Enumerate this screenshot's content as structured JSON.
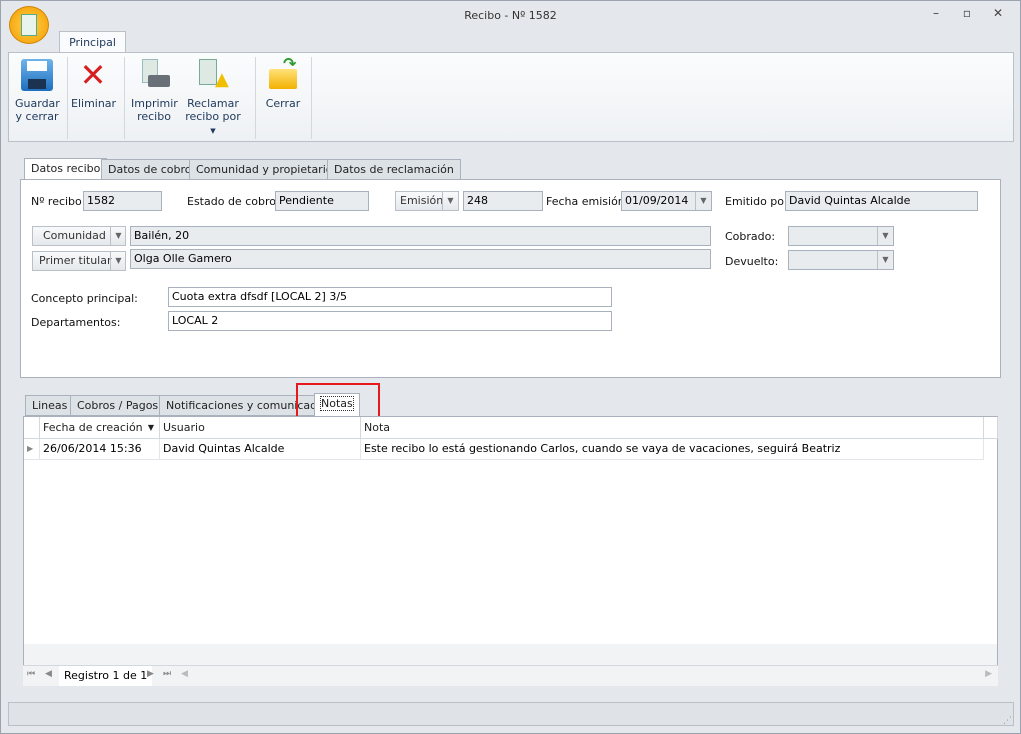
{
  "window": {
    "title": "Recibo - Nº 1582",
    "minimize_icon": "minimize-icon",
    "maximize_icon": "maximize-icon",
    "close_icon": "close-icon"
  },
  "ribbon": {
    "tab": "Principal",
    "buttons": [
      {
        "label1": "Guardar",
        "label2": "y cerrar",
        "icon": "save-icon"
      },
      {
        "label1": "Eliminar",
        "label2": "",
        "icon": "delete-icon"
      },
      {
        "label1": "Imprimir",
        "label2": "recibo",
        "icon": "print-icon"
      },
      {
        "label1": "Reclamar",
        "label2": "recibo por",
        "icon": "claim-warning-icon"
      },
      {
        "label1": "Cerrar",
        "label2": "",
        "icon": "close-folder-icon"
      }
    ]
  },
  "top_tabs": [
    "Datos recibo",
    "Datos de cobro",
    "Comunidad y propietarios",
    "Datos de reclamación"
  ],
  "form": {
    "numero_label": "Nº recibo:",
    "numero": "1582",
    "estado_label": "Estado de cobro:",
    "estado": "Pendiente",
    "emision_button": "Emisión",
    "emision": "248",
    "fecha_label": "Fecha emisión:",
    "fecha": "01/09/2014",
    "emitido_label": "Emitido por:",
    "emitido": "David Quintas Alcalde",
    "comunidad_button": "Comunidad",
    "comunidad": "Bailén, 20",
    "titular_button": "Primer titular",
    "titular": "Olga Olle Gamero",
    "cobrado_label": "Cobrado:",
    "devuelto_label": "Devuelto:",
    "concepto_label": "Concepto principal:",
    "concepto": "Cuota extra dfsdf [LOCAL 2] 3/5",
    "departamentos_label": "Departamentos:",
    "departamentos": "LOCAL 2"
  },
  "bottom_tabs": [
    "Lineas",
    "Cobros / Pagos",
    "Notificaciones y comunicados",
    "Notas"
  ],
  "grid": {
    "columns": [
      "Fecha de creación",
      "Usuario",
      "Nota"
    ],
    "rows": [
      [
        "26/06/2014 15:36",
        "David Quintas Alcalde",
        "Este recibo lo está gestionando Carlos, cuando se vaya de vacaciones, seguirá Beatriz"
      ]
    ],
    "navigator": "Registro 1 de 1"
  },
  "highlight_color": "#e8191a"
}
